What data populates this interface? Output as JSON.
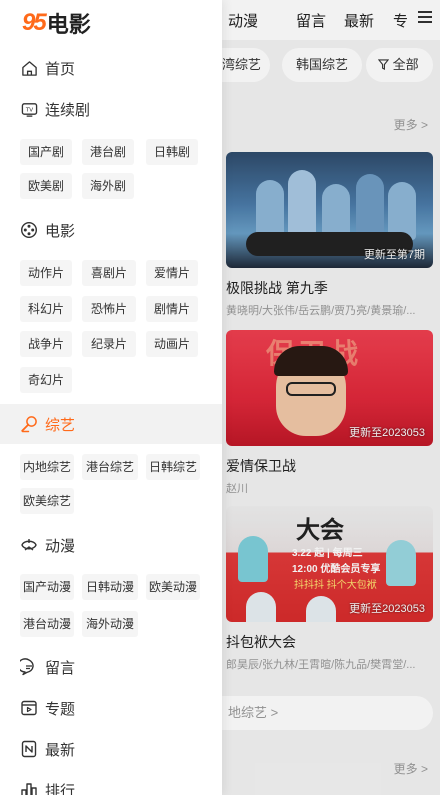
{
  "top_nav": {
    "items": [
      "动漫",
      "留言",
      "最新",
      "专"
    ]
  },
  "chips": [
    "湾综艺",
    "韩国综艺",
    "全部"
  ],
  "more_label": "更多 >",
  "cards": [
    {
      "title": "极限挑战 第九季",
      "cast": "黄晓明/大张伟/岳云鹏/贾乃亮/黄景瑜/...",
      "update": "更新至第7期"
    },
    {
      "title": "爱情保卫战",
      "cast": "赵川",
      "update": "更新至2023053"
    },
    {
      "title": "抖包袱大会",
      "cast": "郎昊辰/张九林/王霄暄/陈九品/樊霄堂/...",
      "update": "更新至2023053",
      "poster_head": "大会",
      "poster_line1": "3.22 起 | 每周三",
      "poster_line2": "12:00 优酷会员专享",
      "poster_line3": "抖抖抖 抖个大包袱"
    }
  ],
  "bottom_chip": "地综艺 >",
  "poster_big_text": "保卫战",
  "logo": {
    "number": "95",
    "text": "电影"
  },
  "drawer": {
    "home": "首页",
    "series": {
      "label": "连续剧",
      "subs": [
        "国产剧",
        "港台剧",
        "日韩剧",
        "欧美剧",
        "海外剧"
      ]
    },
    "movie": {
      "label": "电影",
      "subs": [
        "动作片",
        "喜剧片",
        "爱情片",
        "科幻片",
        "恐怖片",
        "剧情片",
        "战争片",
        "纪录片",
        "动画片",
        "奇幻片"
      ]
    },
    "variety": {
      "label": "综艺",
      "subs": [
        "内地综艺",
        "港台综艺",
        "日韩综艺",
        "欧美综艺"
      ]
    },
    "anime": {
      "label": "动漫",
      "subs": [
        "国产动漫",
        "日韩动漫",
        "欧美动漫",
        "港台动漫",
        "海外动漫"
      ]
    },
    "message": "留言",
    "topic": "专题",
    "latest": "最新",
    "ranking": "排行"
  },
  "colors": {
    "accent": "#ff6a1a"
  }
}
